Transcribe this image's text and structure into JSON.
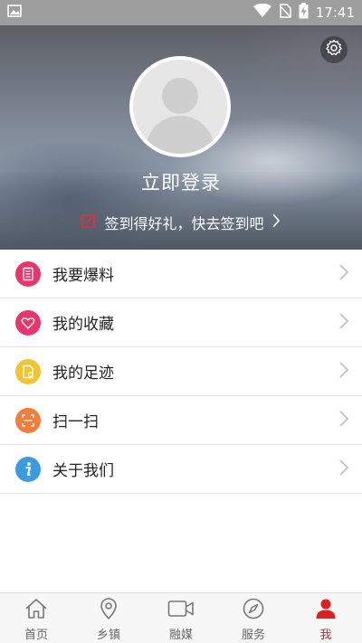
{
  "status_bar": {
    "time": "17:41",
    "icons": [
      "image-notification-icon",
      "wifi-icon",
      "no-sim-icon",
      "battery-charging-icon"
    ]
  },
  "profile": {
    "login_text": "立即登录",
    "signin_text": "签到得好礼，快去签到吧",
    "settings_icon": "gear-icon",
    "avatar_icon": "default-avatar-icon"
  },
  "menu": {
    "items": [
      {
        "label": "我要爆料",
        "icon": "report-document-icon",
        "color": "#e8356b"
      },
      {
        "label": "我的收藏",
        "icon": "heart-icon",
        "color": "#e8356b"
      },
      {
        "label": "我的足迹",
        "icon": "footprint-document-icon",
        "color": "#f3c431"
      },
      {
        "label": "扫一扫",
        "icon": "scan-icon",
        "color": "#f37d3a"
      },
      {
        "label": "关于我们",
        "icon": "info-icon",
        "color": "#3a9be0"
      }
    ]
  },
  "tabbar": {
    "tabs": [
      {
        "label": "首页",
        "icon": "home-icon",
        "active": false
      },
      {
        "label": "乡镇",
        "icon": "location-pin-icon",
        "active": false
      },
      {
        "label": "融媒",
        "icon": "video-camera-icon",
        "active": false
      },
      {
        "label": "服务",
        "icon": "compass-icon",
        "active": false
      },
      {
        "label": "我",
        "icon": "person-icon",
        "active": true
      }
    ],
    "active_color": "#e02020",
    "inactive_color": "#666666"
  }
}
